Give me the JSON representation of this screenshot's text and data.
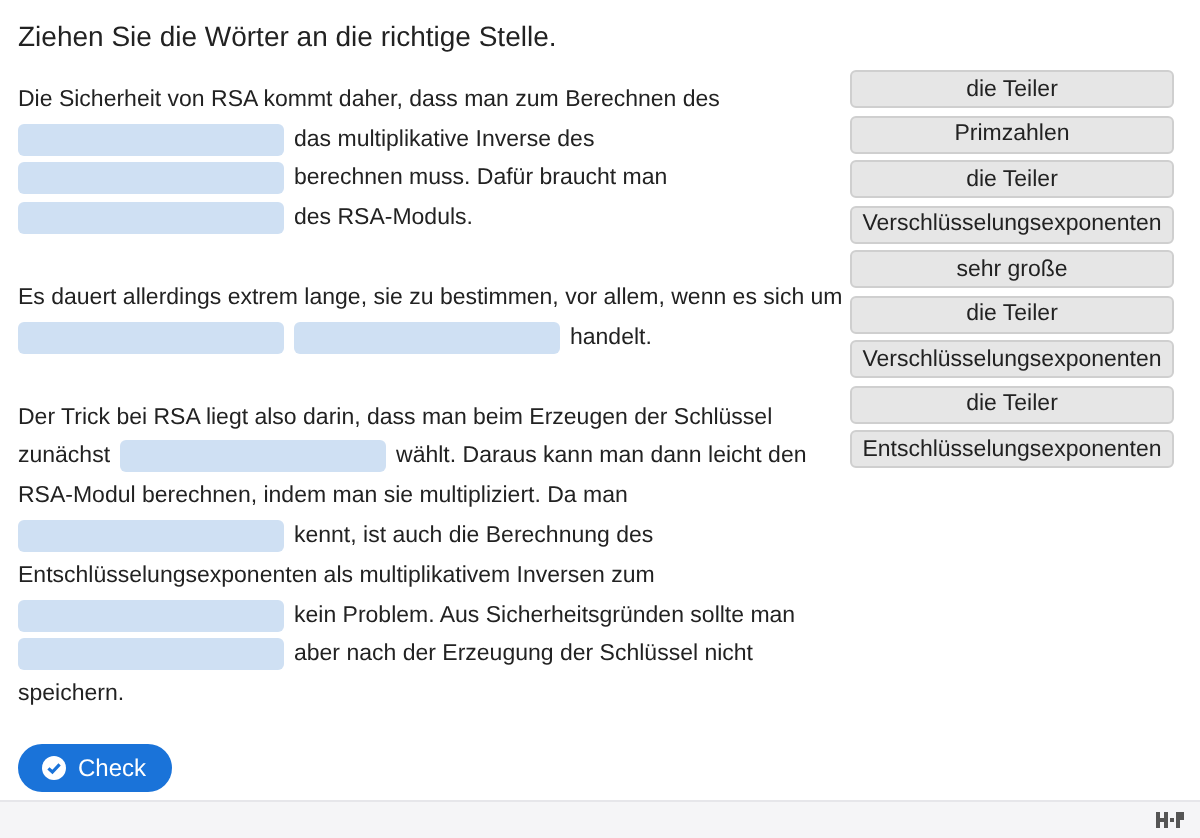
{
  "task": {
    "title": "Ziehen Sie die Wörter an die richtige Stelle."
  },
  "paragraphs": [
    {
      "lines": [
        [
          {
            "kind": "text",
            "text": "Die Sicherheit von RSA kommt daher, dass man zum Berechnen des"
          }
        ],
        [
          {
            "kind": "blank"
          },
          {
            "kind": "text",
            "text": "das multiplikative Inverse des"
          }
        ],
        [
          {
            "kind": "blank"
          },
          {
            "kind": "text",
            "text": "berechnen muss. Dafür braucht man"
          }
        ],
        [
          {
            "kind": "blank"
          },
          {
            "kind": "text",
            "text": "des RSA-Moduls."
          }
        ]
      ]
    },
    {
      "lines": [
        [
          {
            "kind": "text",
            "text": "Es dauert allerdings extrem lange, sie zu bestimmen, vor allem, wenn es sich um"
          }
        ],
        [
          {
            "kind": "blank"
          },
          {
            "kind": "blank"
          },
          {
            "kind": "text",
            "text": "handelt."
          }
        ]
      ]
    },
    {
      "lines": [
        [
          {
            "kind": "text",
            "text": "Der Trick bei RSA liegt also darin, dass man beim Erzeugen der Schlüssel"
          }
        ],
        [
          {
            "kind": "text",
            "text": "zunächst"
          },
          {
            "kind": "blank"
          },
          {
            "kind": "text",
            "text": "wählt. Daraus kann man dann leicht den"
          }
        ],
        [
          {
            "kind": "text",
            "text": "RSA-Modul berechnen, indem man sie multipliziert. Da man"
          }
        ],
        [
          {
            "kind": "blank"
          },
          {
            "kind": "text",
            "text": "kennt, ist auch die Berechnung des"
          }
        ],
        [
          {
            "kind": "text",
            "text": "Entschlüsselungsexponenten als multiplikativem Inversen zum"
          }
        ],
        [
          {
            "kind": "blank"
          },
          {
            "kind": "text",
            "text": "kein Problem. Aus Sicherheitsgründen sollte man"
          }
        ],
        [
          {
            "kind": "blank"
          },
          {
            "kind": "text",
            "text": "aber nach der Erzeugung der Schlüssel nicht"
          }
        ],
        [
          {
            "kind": "text",
            "text": "speichern."
          }
        ]
      ]
    }
  ],
  "words": [
    "die Teiler",
    "Primzahlen",
    "die Teiler",
    "Verschlüsselungsexponenten",
    "sehr große",
    "die Teiler",
    "Verschlüsselungsexponenten",
    "die Teiler",
    "Entschlüsselungsexponenten"
  ],
  "check_button": {
    "label": "Check"
  }
}
